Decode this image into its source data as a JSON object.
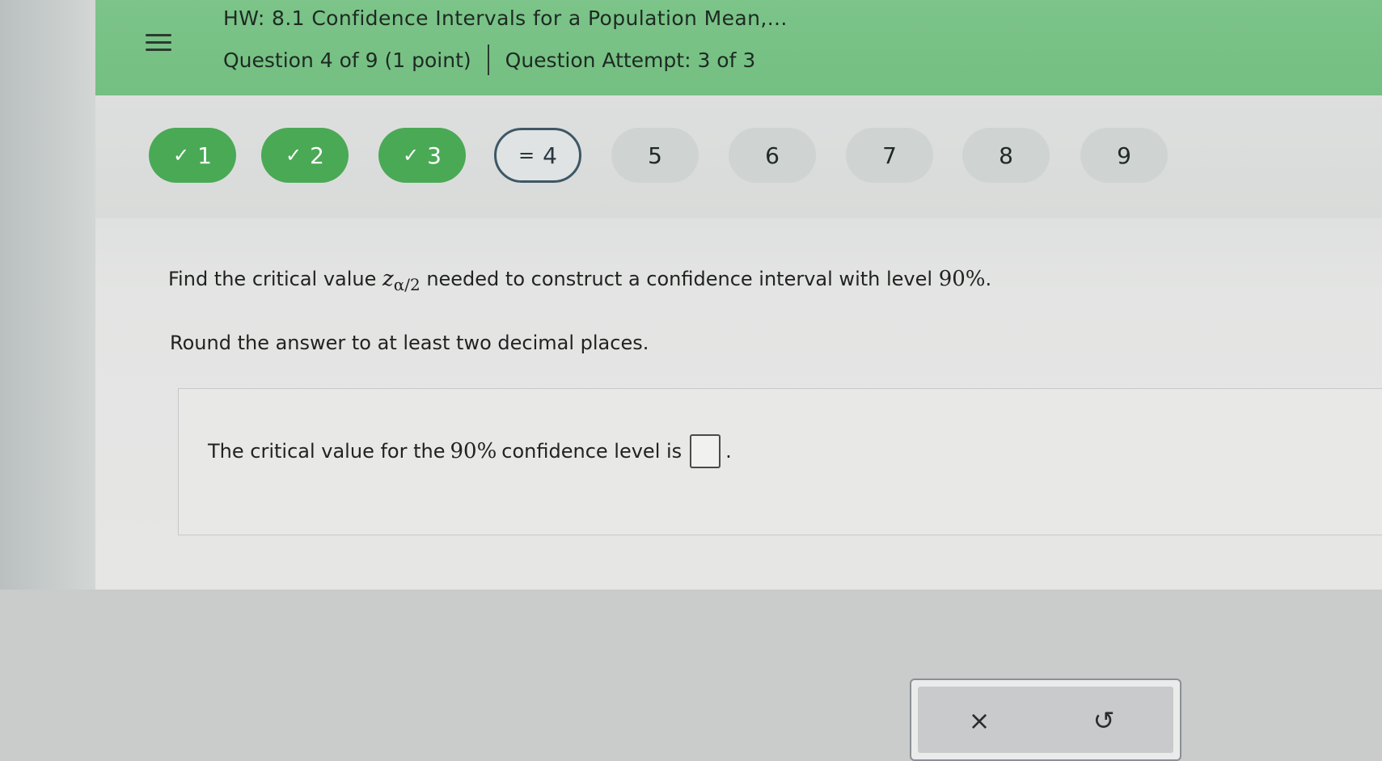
{
  "header": {
    "title": "HW: 8.1 Confidence Intervals for a Population Mean,...",
    "question_info": "Question 4 of 9 (1 point)",
    "attempt_info": "Question Attempt: 3 of 3"
  },
  "nav": {
    "questions": [
      {
        "number": "1",
        "status": "completed",
        "mark": "✓"
      },
      {
        "number": "2",
        "status": "completed",
        "mark": "✓"
      },
      {
        "number": "3",
        "status": "completed",
        "mark": "✓"
      },
      {
        "number": "4",
        "status": "current",
        "mark": "="
      },
      {
        "number": "5",
        "status": "unanswered"
      },
      {
        "number": "6",
        "status": "unanswered"
      },
      {
        "number": "7",
        "status": "unanswered"
      },
      {
        "number": "8",
        "status": "unanswered"
      },
      {
        "number": "9",
        "status": "unanswered"
      }
    ]
  },
  "question": {
    "prompt_before": "Find the critical value ",
    "symbol": "z",
    "subscript": "α/2",
    "prompt_after": " needed to construct a confidence interval with level ",
    "level": "90%",
    "period": ".",
    "instruction": "Round the answer to at least two decimal places."
  },
  "answer": {
    "prefix": "The critical value for the ",
    "level": "90%",
    "suffix": " confidence level is",
    "value": "",
    "trailing": "."
  },
  "tools": {
    "clear_icon": "×",
    "undo_icon": "↺"
  },
  "colors": {
    "header_green": "#74bf82",
    "completed_green": "#4aa955",
    "current_border": "#3e5766",
    "unanswered_gray": "#cfd3d2"
  }
}
